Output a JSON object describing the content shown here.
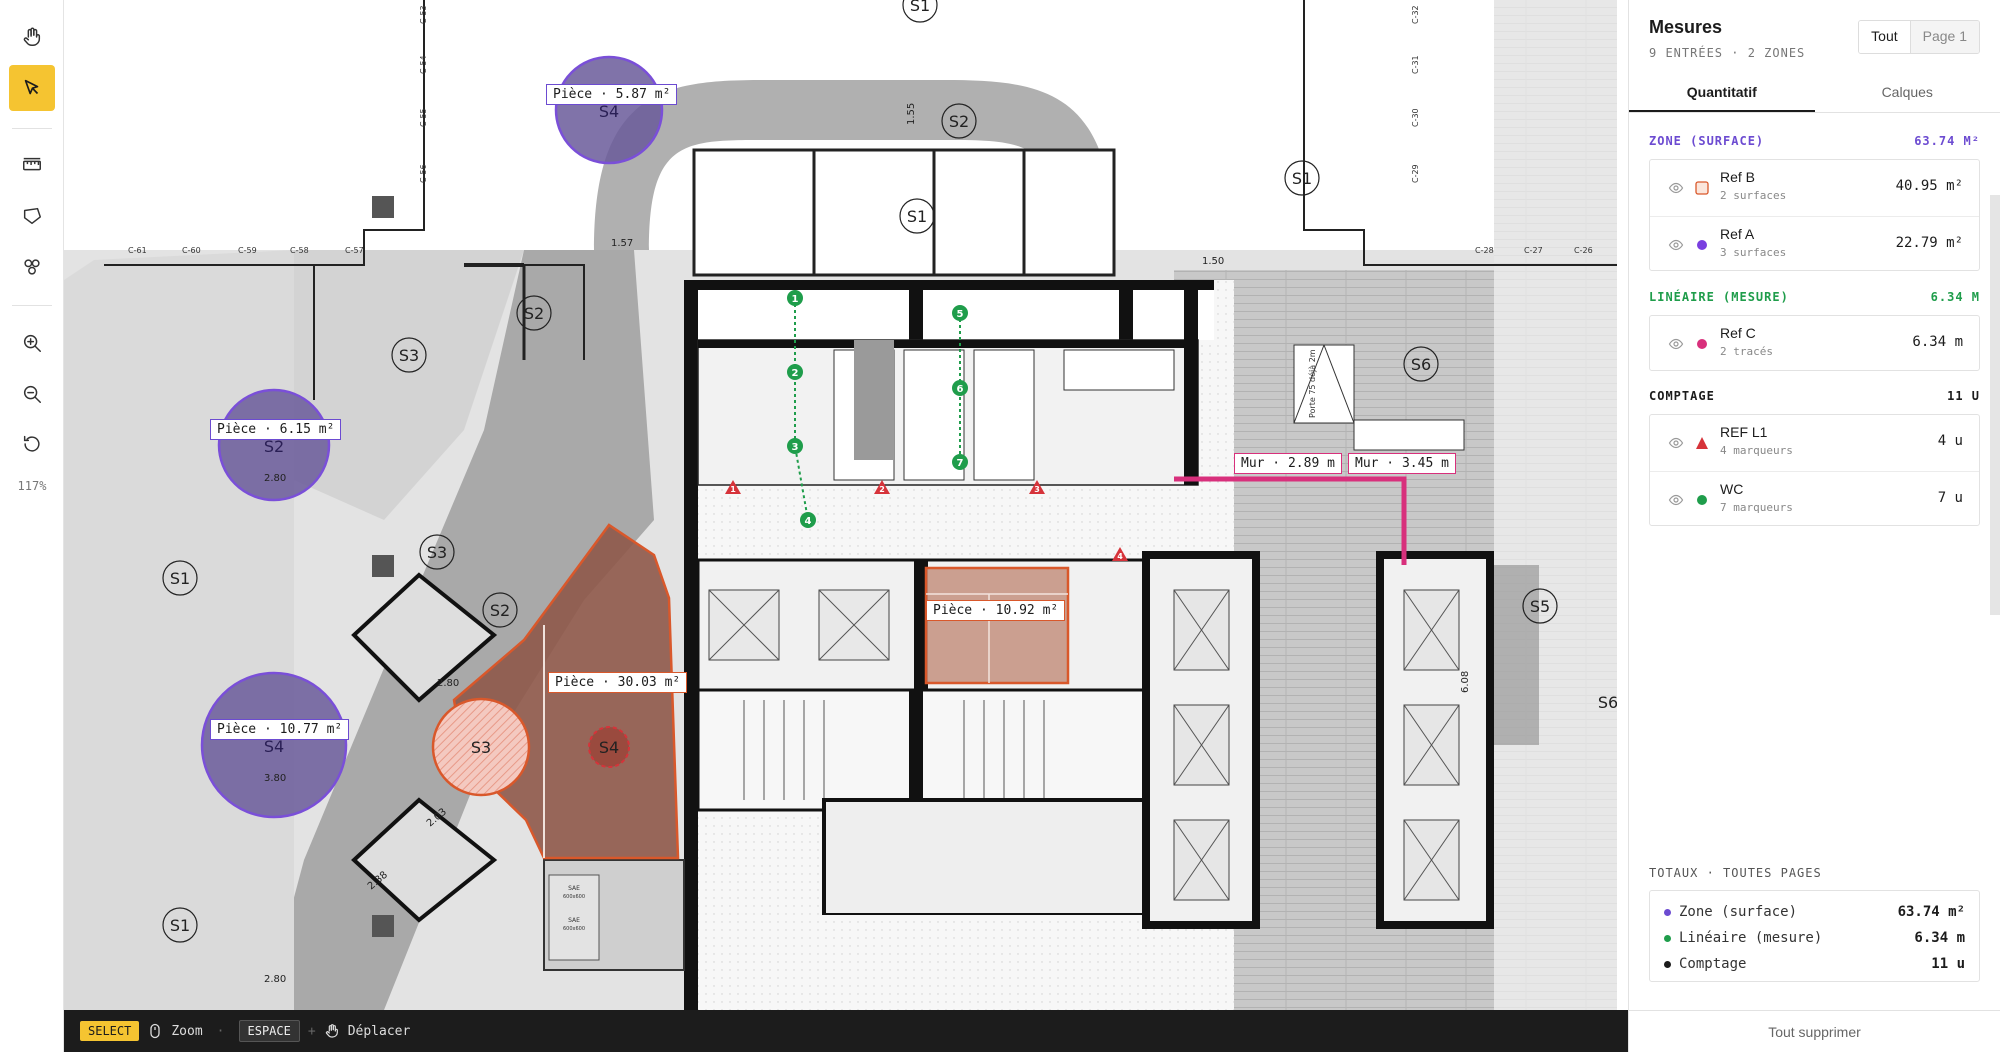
{
  "toolbar": {
    "zoom_level": "117%",
    "tools": [
      {
        "name": "hand-icon",
        "active": false
      },
      {
        "name": "cursor-icon",
        "active": true
      },
      {
        "name": "ruler-icon",
        "active": false
      },
      {
        "name": "polygon-icon",
        "active": false
      },
      {
        "name": "count-icon",
        "active": false
      },
      {
        "name": "zoom-in-icon",
        "active": false
      },
      {
        "name": "zoom-out-icon",
        "active": false
      },
      {
        "name": "reset-icon",
        "active": false
      }
    ],
    "accent": "#f5c431"
  },
  "canvas": {
    "zone_labels": [
      {
        "text": "Pièce · 5.87 m²",
        "kind": "purple"
      },
      {
        "text": "Pièce · 6.15 m²",
        "kind": "purple"
      },
      {
        "text": "Pièce · 10.77 m²",
        "kind": "purple"
      },
      {
        "text": "Pièce · 30.03 m²",
        "kind": "orange"
      },
      {
        "text": "Pièce · 10.92 m²",
        "kind": "orange"
      },
      {
        "text": "Mur · 2.89 m",
        "kind": "pink"
      },
      {
        "text": "Mur · 3.45 m",
        "kind": "pink"
      }
    ],
    "room_codes": [
      "S1",
      "S2",
      "S3",
      "S4",
      "S5",
      "S6"
    ],
    "dimensions": [
      "1.55",
      "1.57",
      "1.50",
      "2.80",
      "2.80",
      "3.80",
      "2.03",
      "2.38",
      "2.80",
      "6.08"
    ],
    "column_labels": [
      "C-61",
      "C-60",
      "C-59",
      "C-58",
      "C-57",
      "C-53",
      "C-54",
      "C-55",
      "C-56",
      "C-32",
      "C-31",
      "C-30",
      "C-29",
      "C-28",
      "C-27",
      "C-26"
    ],
    "count_markers_green": [
      "1",
      "2",
      "3",
      "4",
      "5",
      "6",
      "7"
    ],
    "count_markers_red": [
      "1",
      "2",
      "3",
      "4"
    ],
    "misc_texts": [
      "SAE",
      "SAE",
      "600x600",
      "600x600",
      "Porte 75 déjà 2m"
    ],
    "colors": {
      "purple": "#6c4bd1",
      "orange": "#d9582b",
      "pink": "#d8307c",
      "green": "#1f9d4b",
      "red": "#d6333a"
    }
  },
  "bottombar": {
    "select_key": "SELECT",
    "zoom_label": "Zoom",
    "space_key": "ESPACE",
    "plus": "+",
    "move_label": "Déplacer"
  },
  "panel": {
    "title": "Mesures",
    "subtitle": "9 ENTRÉES · 2 ZONES",
    "toggle": {
      "all": "Tout",
      "page": "Page 1"
    },
    "tabs": [
      "Quantitatif",
      "Calques"
    ],
    "sections": [
      {
        "title": "ZONE (SURFACE)",
        "total": "63.74 M²",
        "color": "#6c4bd1",
        "items": [
          {
            "name": "Ref B",
            "sub": "2 surfaces",
            "value": "40.95 m²",
            "swatch": "square-orange"
          },
          {
            "name": "Ref A",
            "sub": "3 surfaces",
            "value": "22.79 m²",
            "swatch": "dot-purple"
          }
        ]
      },
      {
        "title": "LINÉAIRE (MESURE)",
        "total": "6.34 M",
        "color": "#1f9d4b",
        "items": [
          {
            "name": "Ref C",
            "sub": "2 tracés",
            "value": "6.34 m",
            "swatch": "dot-pink"
          }
        ]
      },
      {
        "title": "COMPTAGE",
        "total": "11 U",
        "color": "#1c1c1c",
        "items": [
          {
            "name": "REF L1",
            "sub": "4 marqueurs",
            "value": "4 u",
            "swatch": "triangle-red"
          },
          {
            "name": "WC",
            "sub": "7 marqueurs",
            "value": "7 u",
            "swatch": "dot-green"
          }
        ]
      }
    ],
    "totals_title": "TOTAUX · TOUTES PAGES",
    "totals": [
      {
        "label": "Zone (surface)",
        "value": "63.74 m²",
        "color": "#6c4bd1"
      },
      {
        "label": "Linéaire (mesure)",
        "value": "6.34 m",
        "color": "#1f9d4b"
      },
      {
        "label": "Comptage",
        "value": "11 u",
        "color": "#1c1c1c"
      }
    ],
    "delete_all": "Tout supprimer"
  }
}
